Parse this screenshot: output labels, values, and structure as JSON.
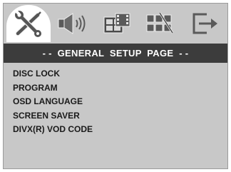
{
  "icon_bar": {
    "tabs": [
      {
        "icon": "general-setup-icon",
        "selected": true
      },
      {
        "icon": "audio-setup-icon",
        "selected": false
      },
      {
        "icon": "video-setup-icon",
        "selected": false
      },
      {
        "icon": "preference-setup-icon",
        "selected": false
      },
      {
        "icon": "exit-icon",
        "selected": false
      }
    ]
  },
  "title": "- -  GENERAL  SETUP  PAGE  - -",
  "menu": {
    "items": [
      "DISC LOCK",
      "PROGRAM",
      "OSD LANGUAGE",
      "SCREEN SAVER",
      "DIVX(R) VOD CODE"
    ]
  },
  "colors": {
    "panel": "#c8c8c8",
    "title_bar": "#3c3c3c",
    "title_text": "#ffffff",
    "selected_tab": "#ffffff",
    "menu_text": "#1a1a1a"
  }
}
